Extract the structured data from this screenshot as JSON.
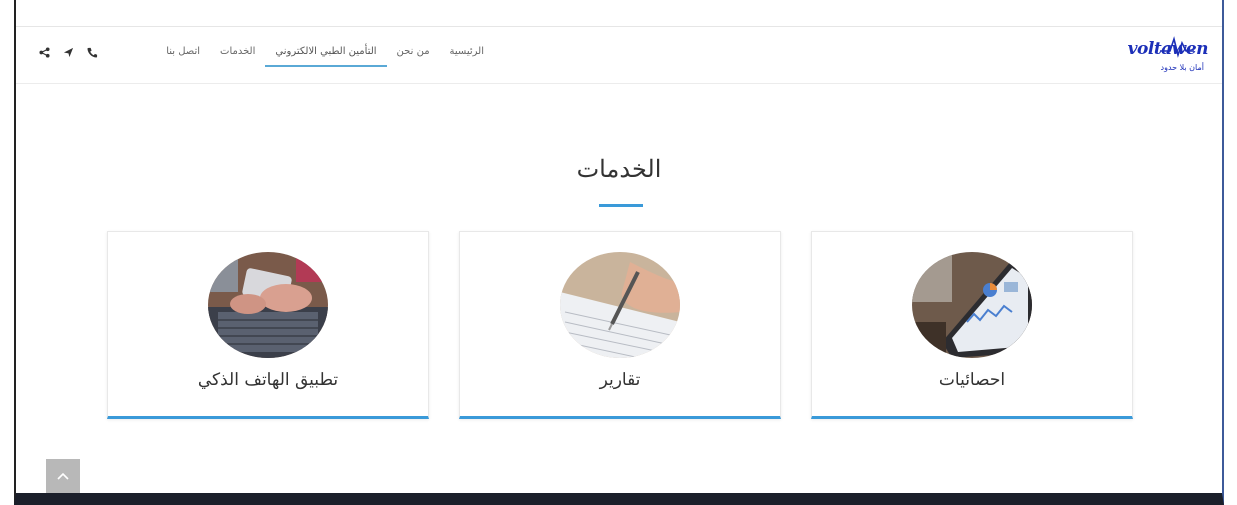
{
  "logo": {
    "brand": "voltawen",
    "tagline": "أمان بلا حدود"
  },
  "nav": {
    "items": [
      {
        "label": "الرئيسية",
        "active": false
      },
      {
        "label": "من نحن",
        "active": false
      },
      {
        "label": "التأمين الطبي الالكتروني",
        "active": true
      },
      {
        "label": "الخدمات",
        "active": false
      },
      {
        "label": "اتصل بنا",
        "active": false
      }
    ],
    "icons": [
      "share-icon",
      "send-icon",
      "phone-icon"
    ]
  },
  "services": {
    "title": "الخدمات",
    "cards": [
      {
        "label": "احصائيات",
        "image": "tablet-charts-image"
      },
      {
        "label": "تقارير",
        "image": "signing-document-image"
      },
      {
        "label": "تطبيق الهاتف الذكي",
        "image": "smartphone-laptop-image"
      }
    ]
  },
  "colors": {
    "accent": "#3a9ad9",
    "logo": "#1c2fb8"
  }
}
